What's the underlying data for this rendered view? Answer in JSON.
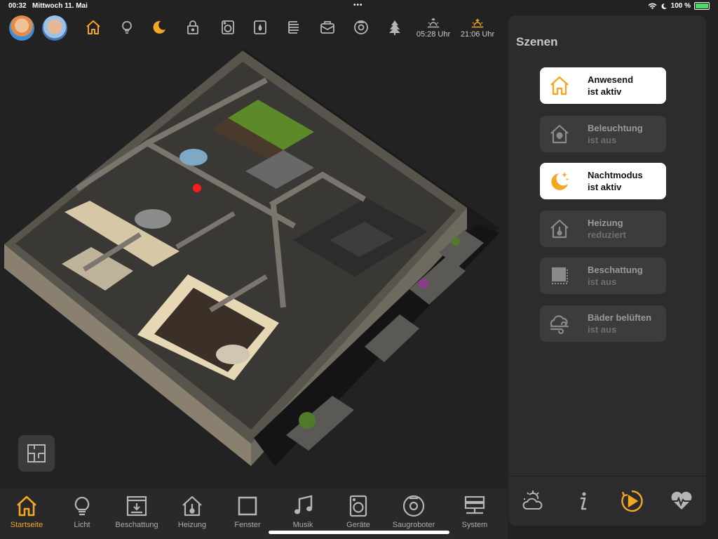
{
  "status_bar": {
    "time": "00:32",
    "date": "Mittwoch 11. Mai",
    "battery": "100 %"
  },
  "top_bar": {
    "icons": [
      "home-icon",
      "lightbulb-icon",
      "moon-icon",
      "lock-icon",
      "washer-icon",
      "dryer-icon",
      "radiator-icon",
      "mailbox-icon",
      "robot-vacuum-icon",
      "tree-icon"
    ],
    "sunrise": "05:28 Uhr",
    "sunset": "21:06 Uhr"
  },
  "panel": {
    "title": "Szenen",
    "scenes": [
      {
        "title": "Anwesend",
        "status": "ist aktiv",
        "active": true,
        "icon": "home-icon"
      },
      {
        "title": "Beleuchtung",
        "status": "ist aus",
        "active": false,
        "icon": "house-light-icon"
      },
      {
        "title": "Nachtmodus",
        "status": "ist aktiv",
        "active": true,
        "icon": "moon-stars-icon"
      },
      {
        "title": "Heizung",
        "status": "reduziert",
        "active": false,
        "icon": "house-thermometer-icon"
      },
      {
        "title": "Beschattung",
        "status": "ist aus",
        "active": false,
        "icon": "shade-icon"
      },
      {
        "title": "Bäder belüften",
        "status": "ist aus",
        "active": false,
        "icon": "wind-icon"
      }
    ],
    "footer_icons": [
      "weather-icon",
      "info-icon",
      "play-scene-icon",
      "heartbeat-icon"
    ]
  },
  "nav": [
    {
      "label": "Startseite",
      "active": true
    },
    {
      "label": "Licht",
      "active": false
    },
    {
      "label": "Beschattung",
      "active": false
    },
    {
      "label": "Heizung",
      "active": false
    },
    {
      "label": "Fenster",
      "active": false
    },
    {
      "label": "Musik",
      "active": false
    },
    {
      "label": "Geräte",
      "active": false
    },
    {
      "label": "Saugroboter",
      "active": false
    },
    {
      "label": "System",
      "active": false
    }
  ],
  "colors": {
    "accent": "#f5a623",
    "background": "#222223",
    "panel": "#2c2c2e"
  }
}
